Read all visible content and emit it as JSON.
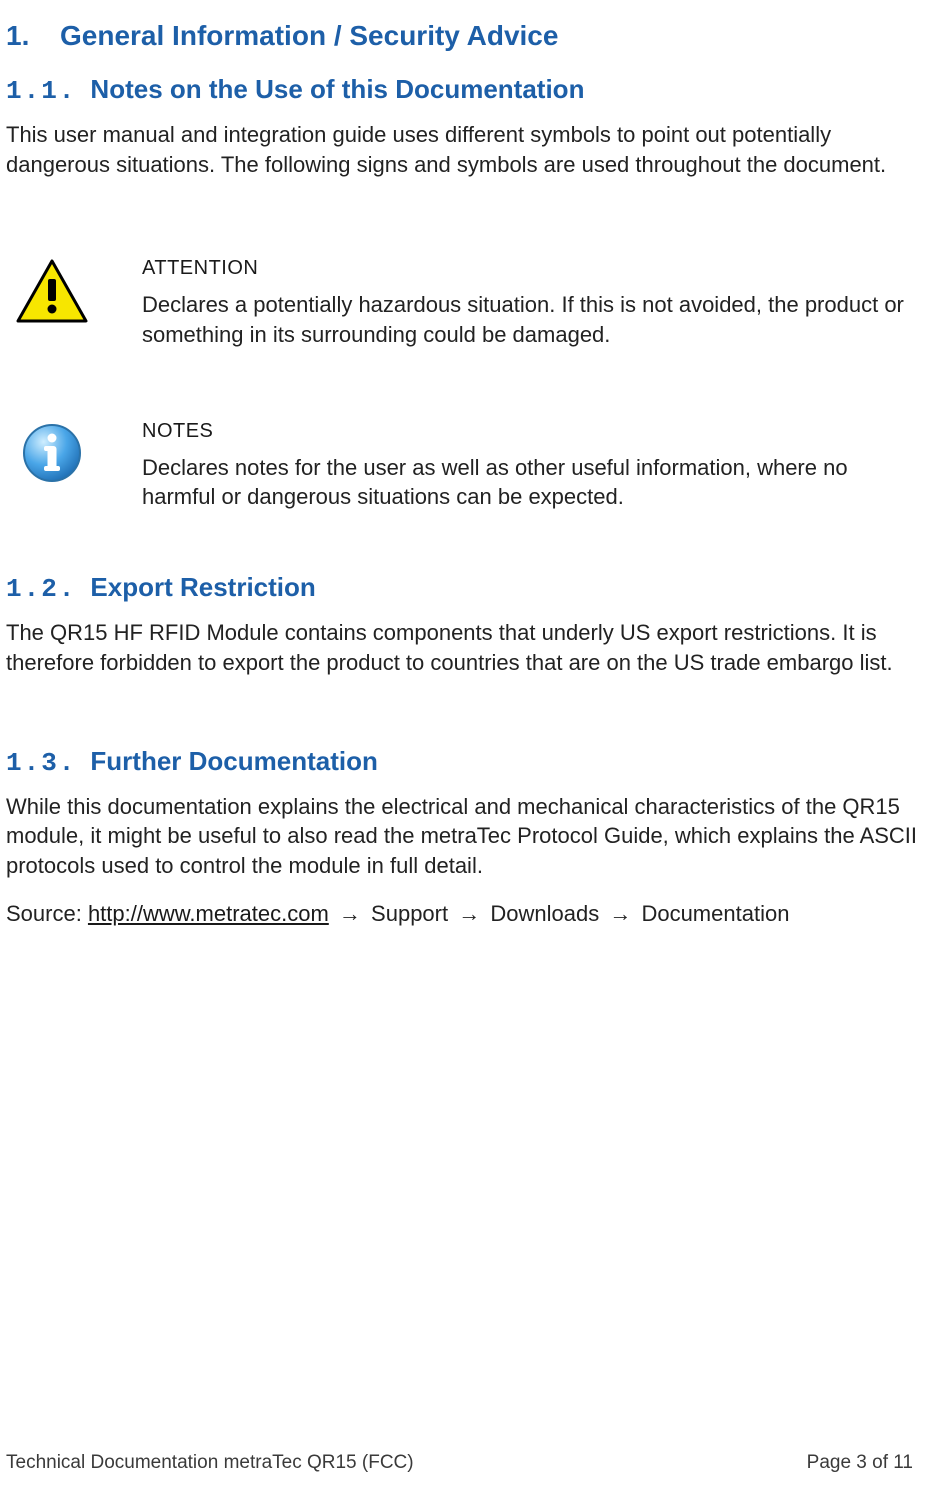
{
  "h1": {
    "num": "1.",
    "title": "General Information / Security Advice"
  },
  "s11": {
    "num": "1.1.",
    "title": "Notes on the Use of this Documentation",
    "para": "This user manual and integration guide uses different symbols to point out potentially dangerous situations. The following signs and symbols are used throughout the document."
  },
  "attention": {
    "label": "ATTENTION",
    "desc": "Declares a potentially hazardous situation. If this is not avoided, the product or something in its surrounding could be damaged."
  },
  "notes": {
    "label": "NOTES",
    "desc": "Declares notes for the user as well as other useful information, where no harmful or dangerous situations can be expected."
  },
  "s12": {
    "num": "1.2.",
    "title": "Export Restriction",
    "para": "The QR15 HF RFID Module contains components that underly US export restrictions. It is therefore forbidden to export the product to countries that are on the US trade embargo list."
  },
  "s13": {
    "num": "1.3.",
    "title": "Further Documentation",
    "para": "While this documentation explains the electrical and mechanical characteristics of the QR15 module, it might be useful to also read the metraTec Protocol Guide, which explains the ASCII protocols used to control the module in full detail.",
    "source_label": "Source: ",
    "source_url_text": "http://www.metratec.com",
    "crumb1": "Support",
    "crumb2": "Downloads",
    "crumb3": "Documentation",
    "arrow": "→"
  },
  "footer": {
    "left": "Technical Documentation metraTec QR15 (FCC)",
    "right": "Page 3 of 11"
  }
}
